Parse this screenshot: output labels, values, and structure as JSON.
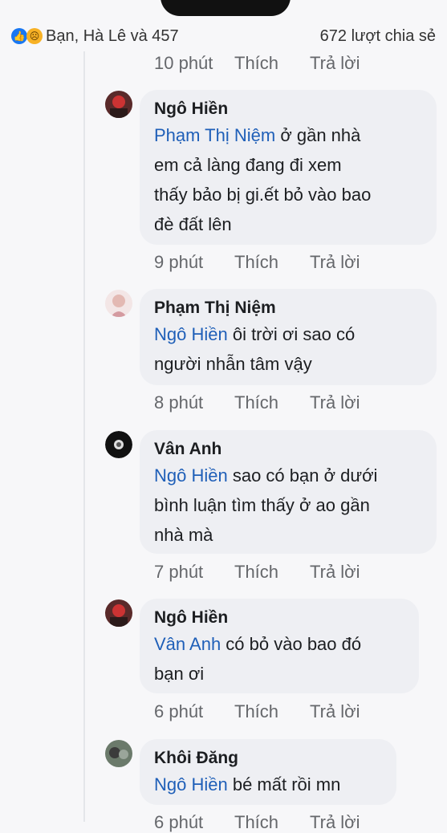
{
  "reactions": {
    "summary": "Bạn, Hà Lê và 457",
    "shares": "672 lượt chia sẻ",
    "like_icon": "like-icon",
    "sad_icon": "sad-icon"
  },
  "comments": [
    {
      "top_actions": {
        "time": "10 phút",
        "like": "Thích",
        "reply": "Trả lời"
      }
    },
    {
      "author": "Ngô Hiền",
      "tag": "Phạm Thị Niệm",
      "text": " ở gần nhà\nem cả làng đang đi xem\nthấy bảo bị gi.ết bỏ vào bao\nđè đất lên",
      "time": "9 phút",
      "like": "Thích",
      "reply": "Trả lời"
    },
    {
      "author": "Phạm Thị Niệm",
      "tag": "Ngô Hiền",
      "text": " ôi trời ơi  sao có\nngười nhẫn tâm vậy",
      "time": "8 phút",
      "like": "Thích",
      "reply": "Trả lời"
    },
    {
      "author": "Vân Anh",
      "tag": "Ngô Hiền",
      "text": " sao có bạn ở dưới\nbình luận tìm thấy ở ao gần\nnhà mà",
      "time": "7 phút",
      "like": "Thích",
      "reply": "Trả lời"
    },
    {
      "author": "Ngô Hiền",
      "tag": "Vân Anh",
      "text": " có bỏ vào bao đó\nbạn ơi",
      "time": "6 phút",
      "like": "Thích",
      "reply": "Trả lời"
    },
    {
      "author": "Khôi Đăng",
      "tag": "Ngô Hiền",
      "text": " bé mất rồi mn",
      "time": "6 phút",
      "like": "Thích",
      "reply": "Trả lời"
    }
  ]
}
